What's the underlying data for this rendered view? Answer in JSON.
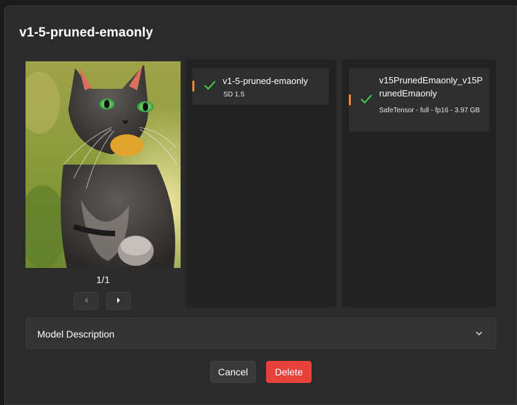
{
  "dialog": {
    "title": "v1-5-pruned-emaonly"
  },
  "preview": {
    "pager": "1/1",
    "prev_icon": "caret-left-icon",
    "next_icon": "caret-right-icon"
  },
  "left_panel": {
    "card": {
      "title": "v1-5-pruned-emaonly",
      "subtitle": "SD 1.5",
      "status_icon": "check-icon"
    }
  },
  "right_panel": {
    "card": {
      "title": "v15PrunedEmaonly_v15PrunedEmaonly",
      "subtitle": "SafeTensor - full - fp16 - 3.97 GB",
      "status_icon": "check-icon"
    }
  },
  "description": {
    "label": "Model Description",
    "icon": "chevron-down-icon"
  },
  "actions": {
    "cancel_label": "Cancel",
    "delete_label": "Delete"
  },
  "colors": {
    "accent_bar": "#f0883e",
    "check": "#3fd14a",
    "danger": "#e8403a"
  }
}
